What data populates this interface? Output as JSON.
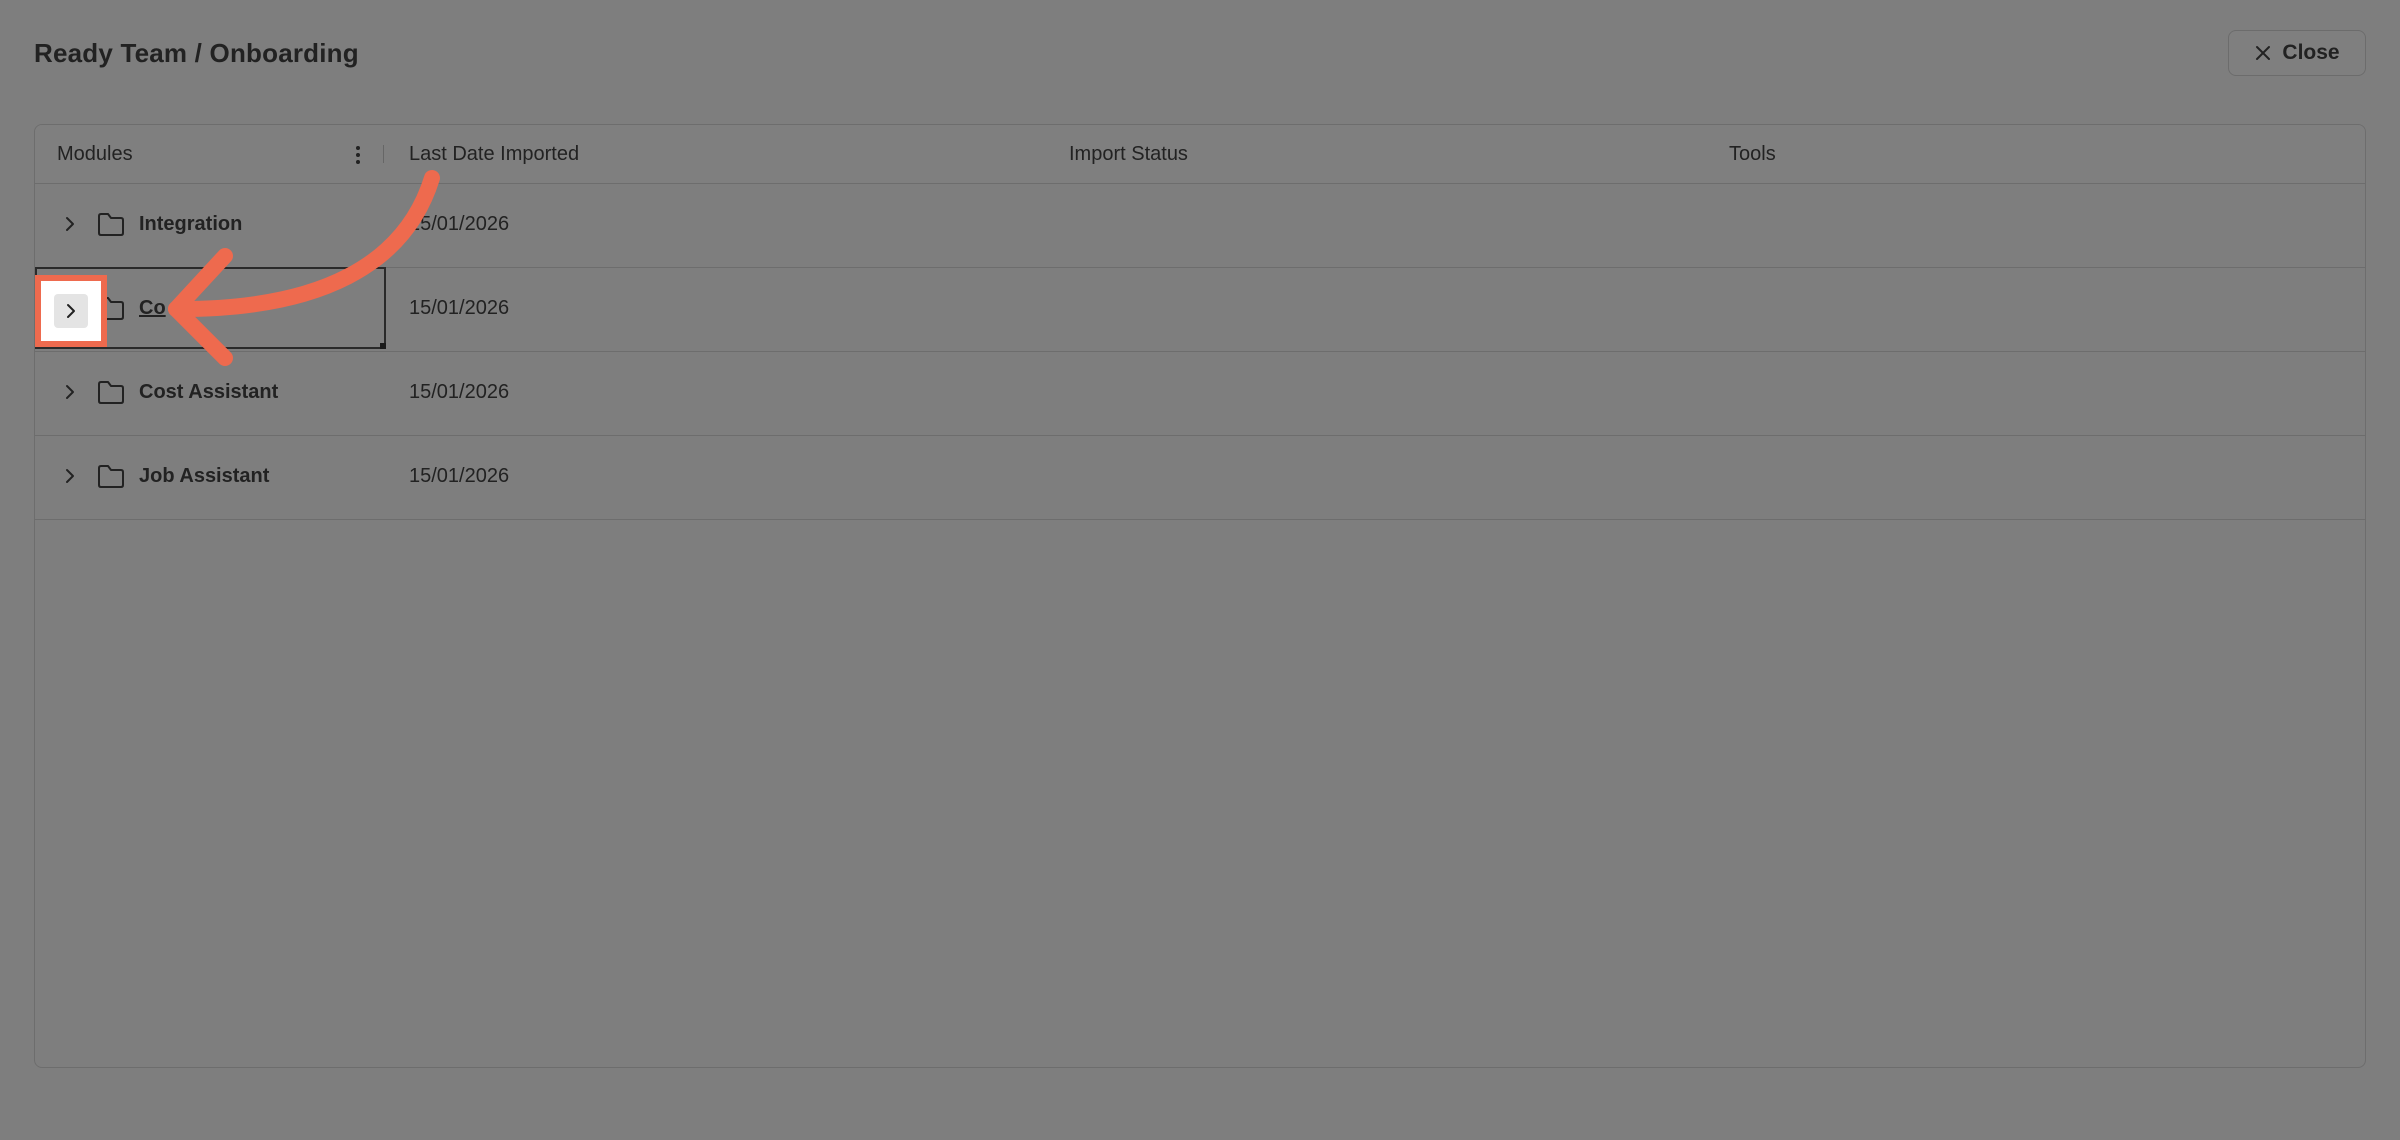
{
  "header": {
    "title": "Ready Team / Onboarding",
    "close_label": "Close"
  },
  "table": {
    "columns": [
      "Modules",
      "Last Date Imported",
      "Import Status",
      "Tools"
    ],
    "rows": [
      {
        "name": "Integration",
        "date": "15/01/2026",
        "status": "",
        "tools": ""
      },
      {
        "name": "Co",
        "date": "15/01/2026",
        "status": "",
        "tools": ""
      },
      {
        "name": "Cost Assistant",
        "date": "15/01/2026",
        "status": "",
        "tools": ""
      },
      {
        "name": "Job Assistant",
        "date": "15/01/2026",
        "status": "",
        "tools": ""
      }
    ]
  },
  "icons": {
    "close": "close-icon",
    "expand": "chevron-right-icon",
    "folder": "folder-icon",
    "column_menu": "kebab-menu-icon"
  },
  "colors": {
    "overlay": "#7e7e7e",
    "annotation": "#ee6a4e"
  }
}
